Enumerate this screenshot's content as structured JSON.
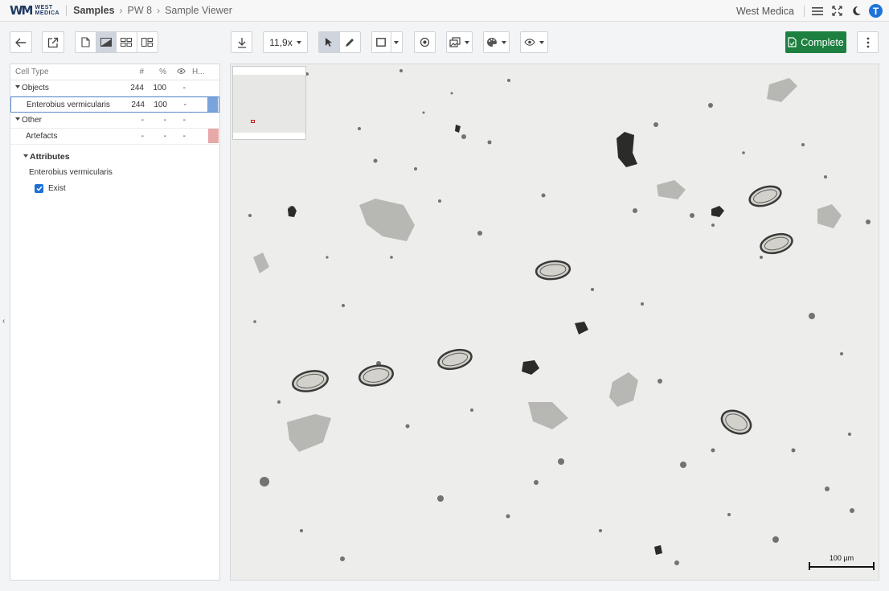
{
  "header": {
    "logo_mark": "WM",
    "logo_line1": "WEST",
    "logo_line2": "MEDICA",
    "breadcrumb": [
      "Samples",
      "PW 8",
      "Sample Viewer"
    ],
    "organization": "West Medica",
    "avatar_initial": "T"
  },
  "toolbar": {
    "zoom_label": "11,9x",
    "complete_label": "Complete",
    "active_view": "image-view",
    "active_tool": "pointer"
  },
  "table": {
    "columns": [
      "Cell Type",
      "#",
      "%",
      "👁",
      "H..."
    ],
    "rows": [
      {
        "name": "Objects",
        "count": "244",
        "pct": "100",
        "eye": "-",
        "group": true
      },
      {
        "name": "Enterobius vermicularis",
        "count": "244",
        "pct": "100",
        "eye": "-",
        "group": false,
        "selected": true,
        "color": "#7aa3dc"
      },
      {
        "name": "Other",
        "count": "-",
        "pct": "-",
        "eye": "-",
        "group": true
      },
      {
        "name": "Artefacts",
        "count": "-",
        "pct": "-",
        "eye": "-",
        "group": false,
        "color": "#e8a8a8"
      }
    ]
  },
  "attributes": {
    "title": "Attributes",
    "cell_name": "Enterobius vermicularis",
    "checkbox_label": "Exist",
    "checked": true
  },
  "viewer": {
    "scale_label": "100 µm"
  }
}
